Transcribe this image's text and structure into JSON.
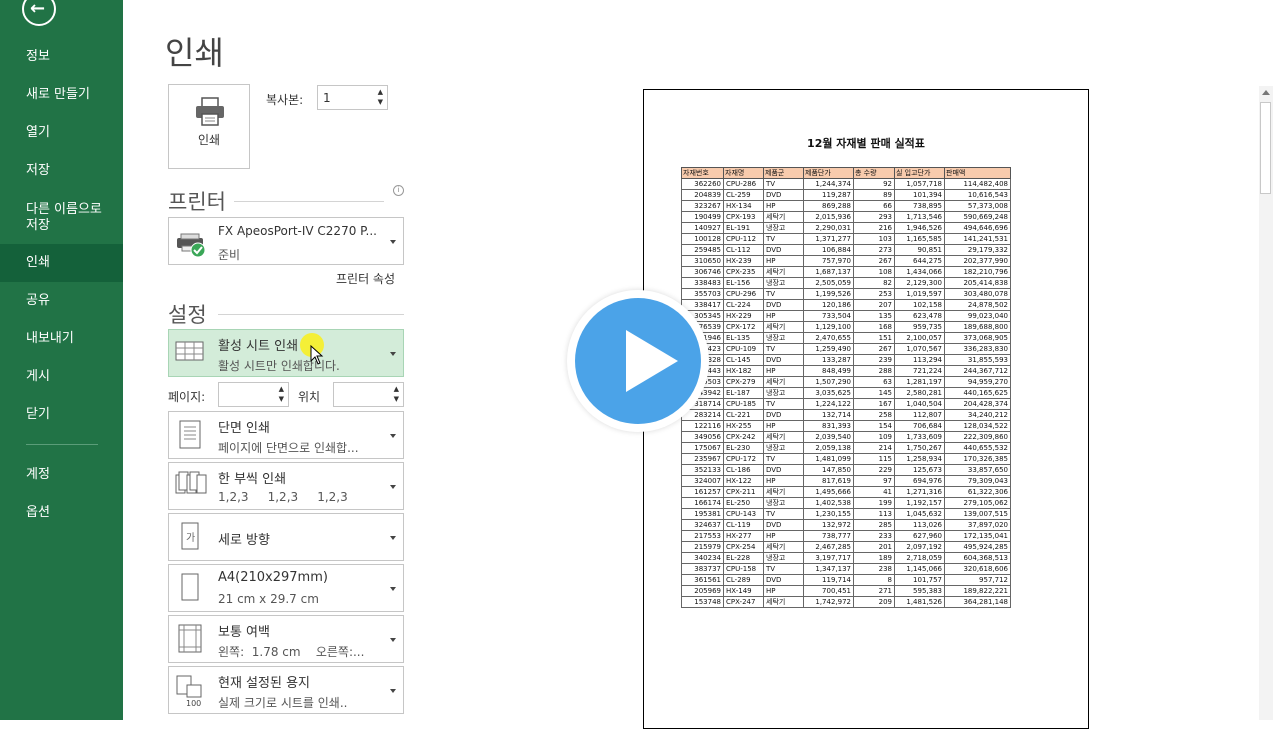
{
  "sidebar": {
    "back_icon": "back-arrow-icon",
    "items": [
      {
        "label": "정보"
      },
      {
        "label": "새로 만들기"
      },
      {
        "label": "열기"
      },
      {
        "label": "저장"
      },
      {
        "label": "다른 이름으로 저장"
      },
      {
        "label": "인쇄",
        "active": true
      },
      {
        "label": "공유"
      },
      {
        "label": "내보내기"
      },
      {
        "label": "게시"
      },
      {
        "label": "닫기"
      },
      {
        "label": "계정"
      },
      {
        "label": "옵션"
      }
    ],
    "color": "#217346"
  },
  "main": {
    "title": "인쇄",
    "print_button": {
      "label": "인쇄",
      "icon": "printer-icon"
    },
    "copies": {
      "label": "복사본:",
      "value": "1"
    },
    "printer_section": {
      "title": "프린터"
    },
    "printer": {
      "name": "FX ApeosPort-IV C2270 P...",
      "status": "준비",
      "icon": "printer-ready-icon"
    },
    "printer_properties": "프린터 속성",
    "settings_section": {
      "title": "설정"
    },
    "settings": [
      {
        "title": "활성 시트 인쇄",
        "subtitle": "활성 시트만 인쇄합니다.",
        "icon": "sheet-grid-icon"
      },
      {
        "title": "단면 인쇄",
        "subtitle": "페이지에 단면으로 인쇄합...",
        "icon": "single-sided-icon"
      },
      {
        "title": "한 부씩 인쇄",
        "subtitle": "1,2,3     1,2,3     1,2,3",
        "icon": "collate-icon"
      },
      {
        "title": "세로 방향",
        "subtitle": "",
        "icon": "portrait-icon"
      },
      {
        "title": "A4(210x297mm)",
        "subtitle": "21 cm x 29.7 cm",
        "icon": "paper-size-icon"
      },
      {
        "title": "보통 여백",
        "subtitle": "왼쪽:  1.78 cm    오른쪽:...",
        "icon": "margins-icon"
      },
      {
        "title": "현재 설정된 용지",
        "subtitle": "실제 크기로 시트를 인쇄..",
        "icon": "scaling-icon"
      }
    ],
    "pages": {
      "label": "페이지:",
      "from": "",
      "to_label": "위치",
      "to": ""
    }
  },
  "preview": {
    "doc_title": "12월 자재별 판매 실적표",
    "headers": [
      "자재번호",
      "자재명",
      "제품군",
      "제품단가",
      "총 수량",
      "실 입고단가",
      "판매액"
    ],
    "rows": [
      [
        "362260",
        "CPU-286",
        "TV",
        "1,244,374",
        "92",
        "1,057,718",
        "114,482,408"
      ],
      [
        "204839",
        "CL-259",
        "DVD",
        "119,287",
        "89",
        "101,394",
        "10,616,543"
      ],
      [
        "323267",
        "HX-134",
        "HP",
        "869,288",
        "66",
        "738,895",
        "57,373,008"
      ],
      [
        "190499",
        "CPX-193",
        "세탁기",
        "2,015,936",
        "293",
        "1,713,546",
        "590,669,248"
      ],
      [
        "140927",
        "EL-191",
        "냉장고",
        "2,290,031",
        "216",
        "1,946,526",
        "494,646,696"
      ],
      [
        "100128",
        "CPU-112",
        "TV",
        "1,371,277",
        "103",
        "1,165,585",
        "141,241,531"
      ],
      [
        "259485",
        "CL-112",
        "DVD",
        "106,884",
        "273",
        "90,851",
        "29,179,332"
      ],
      [
        "310650",
        "HX-239",
        "HP",
        "757,970",
        "267",
        "644,275",
        "202,377,990"
      ],
      [
        "306746",
        "CPX-235",
        "세탁기",
        "1,687,137",
        "108",
        "1,434,066",
        "182,210,796"
      ],
      [
        "338483",
        "EL-156",
        "냉장고",
        "2,505,059",
        "82",
        "2,129,300",
        "205,414,838"
      ],
      [
        "355703",
        "CPU-296",
        "TV",
        "1,199,526",
        "253",
        "1,019,597",
        "303,480,078"
      ],
      [
        "338417",
        "CL-224",
        "DVD",
        "120,186",
        "207",
        "102,158",
        "24,878,502"
      ],
      [
        "305345",
        "HX-229",
        "HP",
        "733,504",
        "135",
        "623,478",
        "99,023,040"
      ],
      [
        "176539",
        "CPX-172",
        "세탁기",
        "1,129,100",
        "168",
        "959,735",
        "189,688,800"
      ],
      [
        "151946",
        "EL-135",
        "냉장고",
        "2,470,655",
        "151",
        "2,100,057",
        "373,068,905"
      ],
      [
        "283423",
        "CPU-109",
        "TV",
        "1,259,490",
        "267",
        "1,070,567",
        "336,283,830"
      ],
      [
        "239328",
        "CL-145",
        "DVD",
        "133,287",
        "239",
        "113,294",
        "31,855,593"
      ],
      [
        "261443",
        "HX-182",
        "HP",
        "848,499",
        "288",
        "721,224",
        "244,367,712"
      ],
      [
        "235503",
        "CPX-279",
        "세탁기",
        "1,507,290",
        "63",
        "1,281,197",
        "94,959,270"
      ],
      [
        "143942",
        "EL-187",
        "냉장고",
        "3,035,625",
        "145",
        "2,580,281",
        "440,165,625"
      ],
      [
        "318714",
        "CPU-185",
        "TV",
        "1,224,122",
        "167",
        "1,040,504",
        "204,428,374"
      ],
      [
        "283214",
        "CL-221",
        "DVD",
        "132,714",
        "258",
        "112,807",
        "34,240,212"
      ],
      [
        "122116",
        "HX-255",
        "HP",
        "831,393",
        "154",
        "706,684",
        "128,034,522"
      ],
      [
        "349056",
        "CPX-242",
        "세탁기",
        "2,039,540",
        "109",
        "1,733,609",
        "222,309,860"
      ],
      [
        "175067",
        "EL-230",
        "냉장고",
        "2,059,138",
        "214",
        "1,750,267",
        "440,655,532"
      ],
      [
        "235967",
        "CPU-172",
        "TV",
        "1,481,099",
        "115",
        "1,258,934",
        "170,326,385"
      ],
      [
        "352133",
        "CL-186",
        "DVD",
        "147,850",
        "229",
        "125,673",
        "33,857,650"
      ],
      [
        "324007",
        "HX-122",
        "HP",
        "817,619",
        "97",
        "694,976",
        "79,309,043"
      ],
      [
        "161257",
        "CPX-211",
        "세탁기",
        "1,495,666",
        "41",
        "1,271,316",
        "61,322,306"
      ],
      [
        "166174",
        "EL-250",
        "냉장고",
        "1,402,538",
        "199",
        "1,192,157",
        "279,105,062"
      ],
      [
        "195381",
        "CPU-143",
        "TV",
        "1,230,155",
        "113",
        "1,045,632",
        "139,007,515"
      ],
      [
        "324637",
        "CL-119",
        "DVD",
        "132,972",
        "285",
        "113,026",
        "37,897,020"
      ],
      [
        "217553",
        "HX-277",
        "HP",
        "738,777",
        "233",
        "627,960",
        "172,135,041"
      ],
      [
        "215979",
        "CPX-254",
        "세탁기",
        "2,467,285",
        "201",
        "2,097,192",
        "495,924,285"
      ],
      [
        "340234",
        "EL-228",
        "냉장고",
        "3,197,717",
        "189",
        "2,718,059",
        "604,368,513"
      ],
      [
        "383737",
        "CPU-158",
        "TV",
        "1,347,137",
        "238",
        "1,145,066",
        "320,618,606"
      ],
      [
        "361561",
        "CL-289",
        "DVD",
        "119,714",
        "8",
        "101,757",
        "957,712"
      ],
      [
        "205969",
        "HX-149",
        "HP",
        "700,451",
        "271",
        "595,383",
        "189,822,221"
      ],
      [
        "153748",
        "CPX-247",
        "세탁기",
        "1,742,972",
        "209",
        "1,481,526",
        "364,281,148"
      ]
    ]
  },
  "overlay": {
    "play_icon": "play-button-icon",
    "color": "#4ba3e8"
  },
  "colors": {
    "header_fill": "#f8cbad",
    "active_setting": "#d3ecd9"
  }
}
